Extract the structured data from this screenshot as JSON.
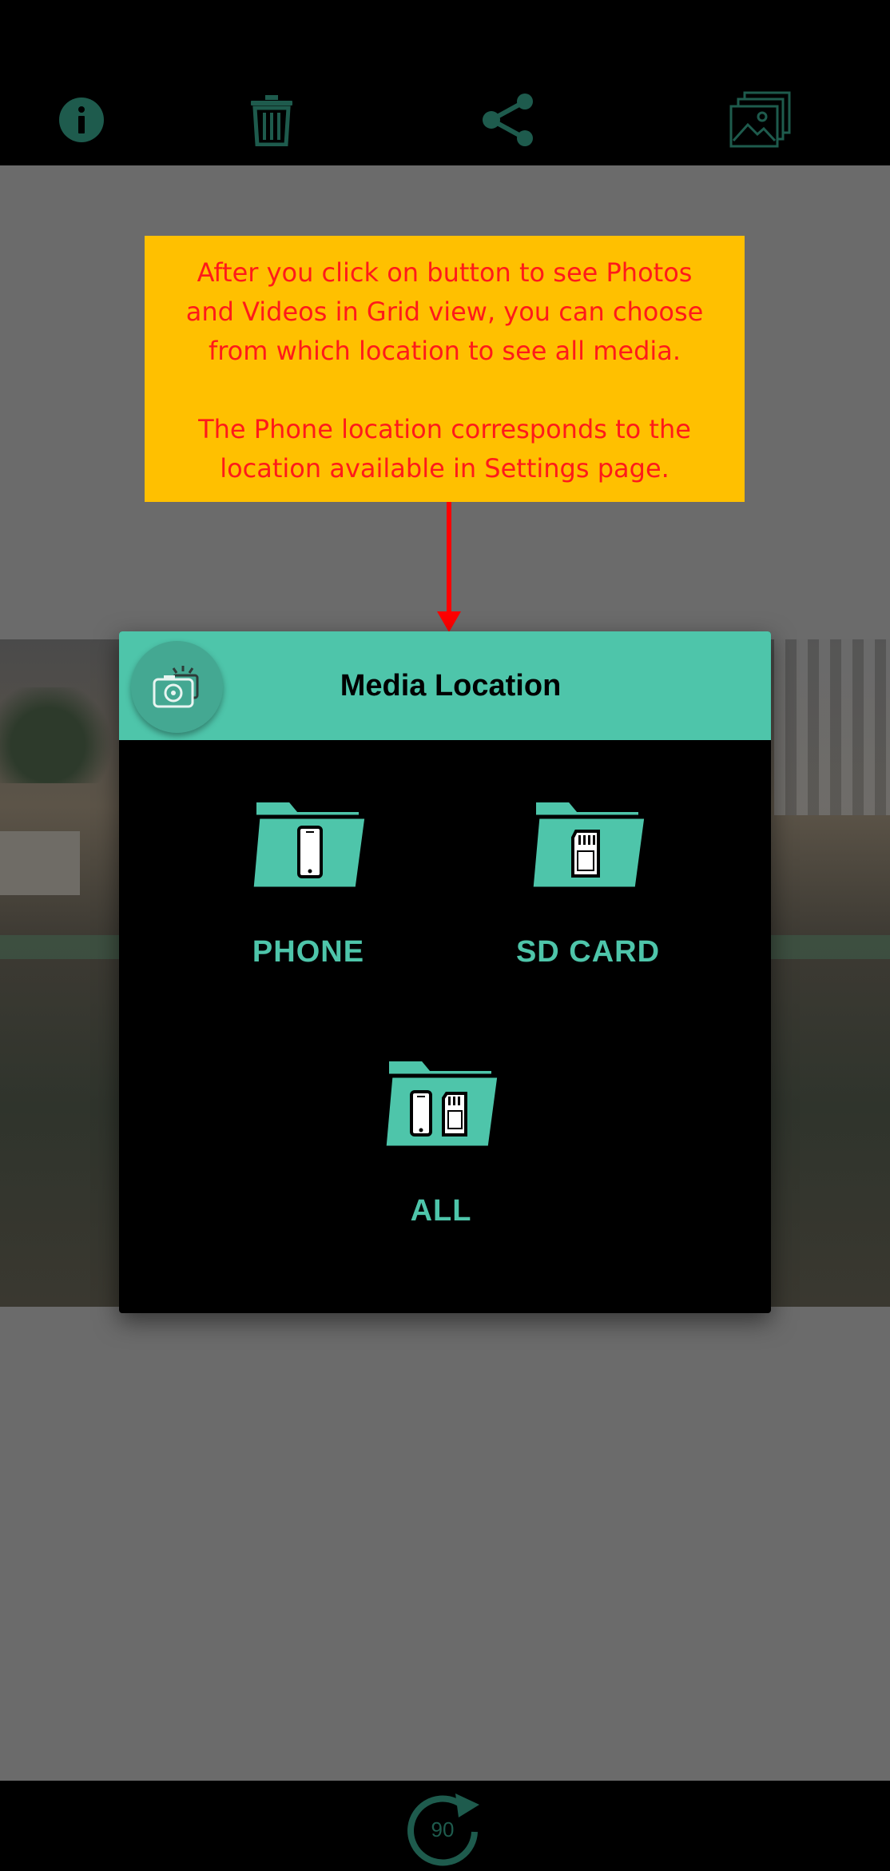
{
  "toolbar": {
    "icons": [
      "info-icon",
      "trash-icon",
      "share-icon",
      "gallery-icon"
    ]
  },
  "callout": {
    "line1": "After you click on button to see Photos",
    "line2": "and Videos in Grid view, you can choose",
    "line3": "from which location to see all media.",
    "line4": "The Phone location corresponds to the",
    "line5": "location available in Settings page."
  },
  "dialog": {
    "title": "Media Location",
    "options": [
      {
        "label": "PHONE",
        "icon": "phone-folder-icon"
      },
      {
        "label": "SD CARD",
        "icon": "sdcard-folder-icon"
      },
      {
        "label": "ALL",
        "icon": "all-folder-icon"
      }
    ]
  },
  "bottom": {
    "rotate_label": "90"
  },
  "colors": {
    "accent": "#4ec5aa",
    "callout_bg": "#ffc000",
    "callout_text": "#ff1a1a",
    "arrow": "#ff0000",
    "icon_dark": "#1e5b4d"
  }
}
